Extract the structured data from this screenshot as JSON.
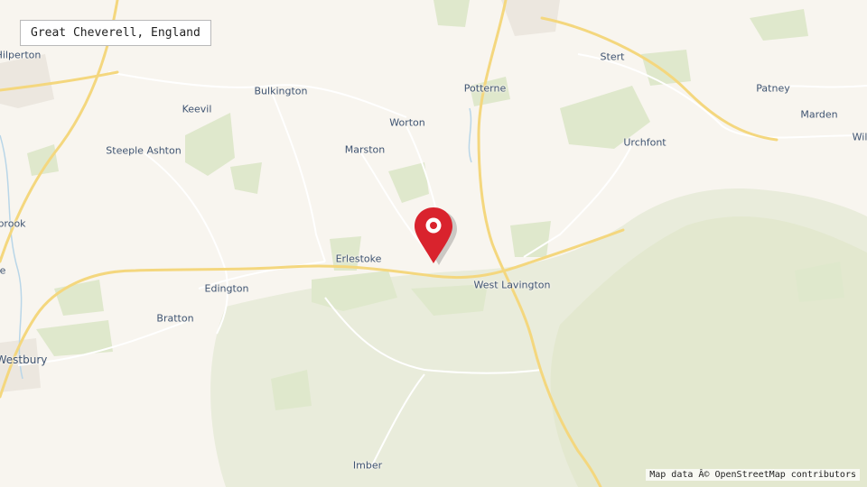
{
  "map": {
    "title": "Great Cheverell, England",
    "attribution": "Map data Â© OpenStreetMap contributors",
    "marker_icon": "map-pin-icon",
    "colors": {
      "land": "#f8f5ef",
      "woodland": "#e4ead2",
      "road_major": "#f4d77e",
      "road_minor": "#ffffff",
      "water": "#b9d6e8",
      "marker": "#d9232d"
    },
    "places": [
      {
        "id": "hilperton",
        "label": "Hilperton"
      },
      {
        "id": "bulkington",
        "label": "Bulkington"
      },
      {
        "id": "keevil",
        "label": "Keevil"
      },
      {
        "id": "steeple-ashton",
        "label": "Steeple Ashton"
      },
      {
        "id": "worton",
        "label": "Worton"
      },
      {
        "id": "marston",
        "label": "Marston"
      },
      {
        "id": "potterne",
        "label": "Potterne"
      },
      {
        "id": "stert",
        "label": "Stert"
      },
      {
        "id": "patney",
        "label": "Patney"
      },
      {
        "id": "marden",
        "label": "Marden"
      },
      {
        "id": "wilsford",
        "label": "Wil"
      },
      {
        "id": "urchfont",
        "label": "Urchfont"
      },
      {
        "id": "southbrook",
        "label": "brook"
      },
      {
        "id": "westbury-leigh",
        "label": "e"
      },
      {
        "id": "erlestoke",
        "label": "Erlestoke"
      },
      {
        "id": "west-lavington",
        "label": "West Lavington"
      },
      {
        "id": "edington",
        "label": "Edington"
      },
      {
        "id": "bratton",
        "label": "Bratton"
      },
      {
        "id": "westbury",
        "label": "Westbury"
      },
      {
        "id": "imber",
        "label": "Imber"
      }
    ]
  }
}
